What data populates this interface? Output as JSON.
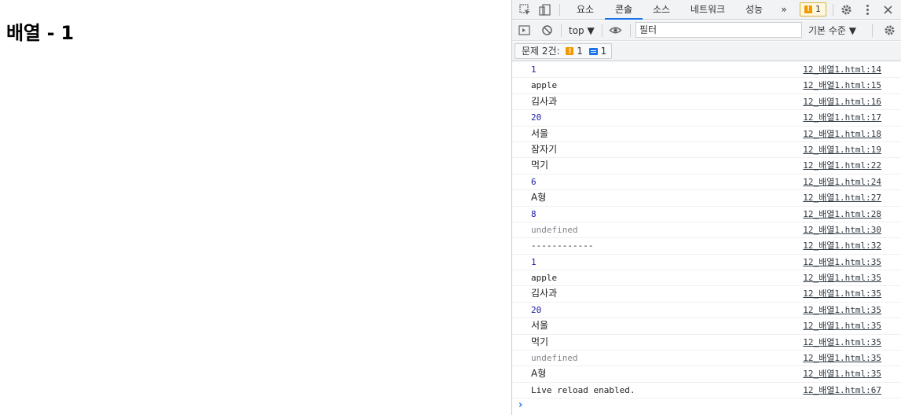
{
  "page": {
    "heading": "배열 - 1"
  },
  "devtools": {
    "tabs": [
      {
        "label": "요소"
      },
      {
        "label": "콘솔"
      },
      {
        "label": "소스"
      },
      {
        "label": "네트워크"
      },
      {
        "label": "성능"
      }
    ],
    "more_tabs": "»",
    "issues_badge_count": "1",
    "toolbar": {
      "context": "top ▼",
      "filter_placeholder": "필터",
      "levels": "기본 수준 ▼"
    },
    "issues_bar": {
      "label": "문제 2건:",
      "warning_count": "1",
      "info_count": "1"
    },
    "console": {
      "rows": [
        {
          "text": "1",
          "source": "12_배열1.html:14"
        },
        {
          "text": "apple",
          "source": "12_배열1.html:15"
        },
        {
          "text": "김사과",
          "source": "12_배열1.html:16"
        },
        {
          "text": "20",
          "source": "12_배열1.html:17"
        },
        {
          "text": "서울",
          "source": "12_배열1.html:18"
        },
        {
          "text": "잠자기",
          "source": "12_배열1.html:19"
        },
        {
          "text": "먹기",
          "source": "12_배열1.html:22"
        },
        {
          "text": "6",
          "source": "12_배열1.html:24"
        },
        {
          "text": "A형",
          "source": "12_배열1.html:27"
        },
        {
          "text": "8",
          "source": "12_배열1.html:28"
        },
        {
          "text": "undefined",
          "source": "12_배열1.html:30"
        },
        {
          "text": "------------",
          "source": "12_배열1.html:32"
        },
        {
          "text": "1",
          "source": "12_배열1.html:35"
        },
        {
          "text": "apple",
          "source": "12_배열1.html:35"
        },
        {
          "text": "김사과",
          "source": "12_배열1.html:35"
        },
        {
          "text": "20",
          "source": "12_배열1.html:35"
        },
        {
          "text": "서울",
          "source": "12_배열1.html:35"
        },
        {
          "text": "먹기",
          "source": "12_배열1.html:35"
        },
        {
          "text": "undefined",
          "source": "12_배열1.html:35"
        },
        {
          "text": "A형",
          "source": "12_배열1.html:35"
        },
        {
          "text": "Live reload enabled.",
          "source": "12_배열1.html:67"
        }
      ],
      "prompt": "›"
    },
    "colors": {
      "accent": "#1a73e8",
      "warning": "#f29900",
      "number": "#1a1aa6"
    }
  }
}
